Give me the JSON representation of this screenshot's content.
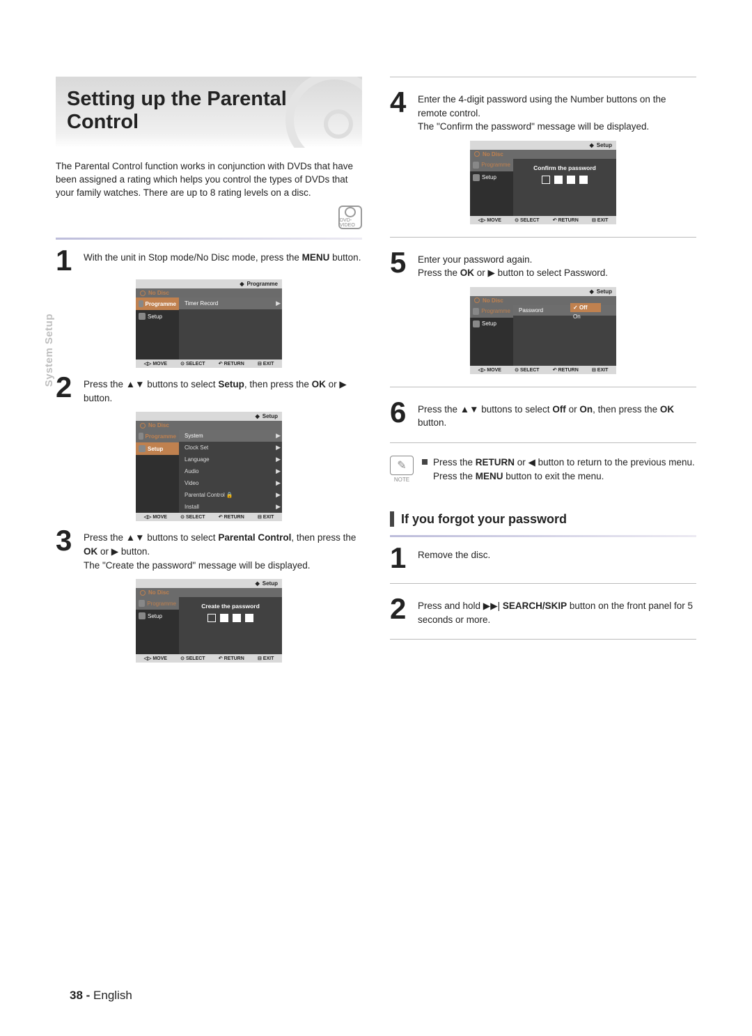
{
  "section_tab": "System Setup",
  "title": "Setting up the Parental Control",
  "intro": "The Parental Control function works in conjunction with DVDs that have been assigned a rating which helps you control the types of DVDs that your family watches. There are up to 8 rating levels on a disc.",
  "dvd_badge": "DVD-VIDEO",
  "left_steps": {
    "s1": {
      "num": "1",
      "text_a": "With the unit in Stop mode/No Disc mode, press the ",
      "bold_a": "MENU",
      "text_b": " button."
    },
    "s2": {
      "num": "2",
      "text_a": "Press the ▲▼ buttons to select ",
      "bold_a": "Setup",
      "text_b": ", then press the ",
      "bold_b": "OK",
      "text_c": " or ▶ button."
    },
    "s3": {
      "num": "3",
      "text_a": "Press the ▲▼ buttons to select ",
      "bold_a": "Parental Control",
      "text_b": ", then press the ",
      "bold_b": "OK",
      "text_c": " or ▶ button.",
      "text_d": "The \"Create the password\" message will be displayed."
    }
  },
  "right_steps": {
    "s4": {
      "num": "4",
      "text_a": "Enter the 4-digit password using the Number buttons on the remote control.",
      "text_b": "The \"Confirm the password\" message will be displayed."
    },
    "s5": {
      "num": "5",
      "text_a": "Enter your password again.",
      "text_b": "Press the ",
      "bold_a": "OK",
      "text_c": " or ▶ button to select Password."
    },
    "s6": {
      "num": "6",
      "text_a": "Press the ▲▼ buttons to select ",
      "bold_a": "Off",
      "text_b": " or ",
      "bold_b": "On",
      "text_c": ", then press the ",
      "bold_c": "OK",
      "text_d": " button."
    }
  },
  "note": {
    "label": "NOTE",
    "line1_a": "Press the ",
    "line1_b": "RETURN",
    "line1_c": " or ◀ button to return to the previous menu.",
    "line2_a": "Press the ",
    "line2_b": "MENU",
    "line2_c": " button to exit the menu."
  },
  "forgot": {
    "heading": "If you forgot your password",
    "s1": {
      "num": "1",
      "text": "Remove the disc."
    },
    "s2": {
      "num": "2",
      "text_a": "Press and hold ▶▶| ",
      "bold_a": "SEARCH/SKIP",
      "text_b": " button on the front panel for 5 seconds or more."
    }
  },
  "osd_common": {
    "no_disc": "No Disc",
    "programme": "Programme",
    "setup": "Setup",
    "nav_move": "MOVE",
    "nav_select": "SELECT",
    "nav_return": "RETURN",
    "nav_exit": "EXIT"
  },
  "osd1": {
    "crumb": "Programme",
    "right_item": "Timer Record"
  },
  "osd2": {
    "crumb": "Setup",
    "items": [
      "System",
      "Clock Set",
      "Language",
      "Audio",
      "Video",
      "Parental Control",
      "Install"
    ],
    "lock_idx": 5
  },
  "osd3": {
    "crumb": "Setup",
    "msg": "Create the password"
  },
  "osd4": {
    "crumb": "Setup",
    "msg": "Confirm the password"
  },
  "osd5": {
    "crumb": "Setup",
    "label": "Password",
    "opt_off": "Off",
    "opt_on": "On"
  },
  "footer": {
    "page": "38 - ",
    "lang": "English"
  }
}
